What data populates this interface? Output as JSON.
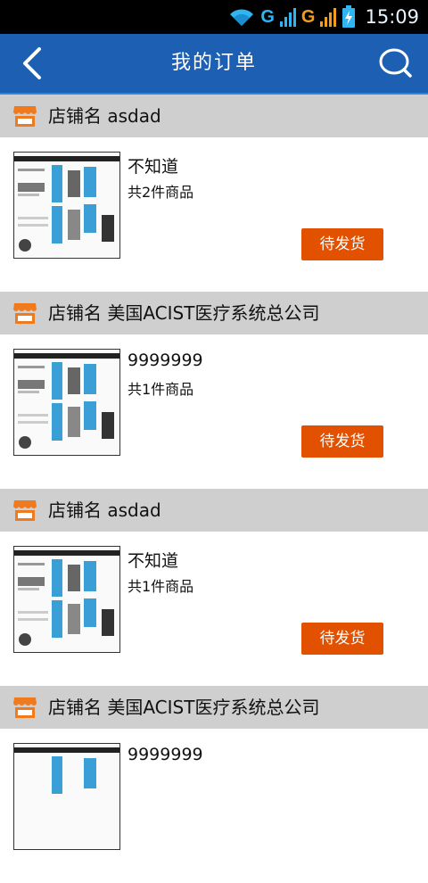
{
  "status_bar": {
    "time": "15:09",
    "network1": "G",
    "network2": "G"
  },
  "header": {
    "title": "我的订单"
  },
  "orders": [
    {
      "shop": "店铺名 asdad",
      "product": "不知道",
      "count": "共2件商品",
      "status": "待发货"
    },
    {
      "shop": "店铺名 美国ACIST医疗系统总公司",
      "product": "9999999",
      "count": "共1件商品",
      "status": "待发货"
    },
    {
      "shop": "店铺名 asdad",
      "product": "不知道",
      "count": "共1件商品",
      "status": "待发货"
    },
    {
      "shop": "店铺名 美国ACIST医疗系统总公司",
      "product": "9999999",
      "count": "",
      "status": ""
    }
  ],
  "colors": {
    "header": "#1d5fb3",
    "shop_bar": "#cfcfcf",
    "accent": "#e25100"
  }
}
